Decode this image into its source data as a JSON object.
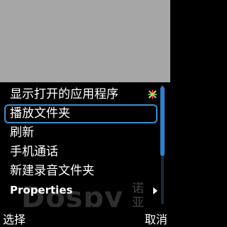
{
  "menu": {
    "items": [
      {
        "label": "显示打开的应用程序",
        "icon": "multicolor-star-icon"
      },
      {
        "label": "播放文件夹",
        "selected": true
      },
      {
        "label": "刷新"
      },
      {
        "label": "手机通话"
      },
      {
        "label": "新建录音文件夹"
      },
      {
        "label": "Properties",
        "icon": "submenu-arrow-icon"
      }
    ]
  },
  "softkeys": {
    "left": "选择",
    "right": "取消"
  },
  "watermark": {
    "brand": "Dospy",
    "chinese": "诺亚方舟"
  },
  "colors": {
    "accent": "#3a8fd1",
    "background": "#000000",
    "top_area": "#a6a6a6"
  }
}
